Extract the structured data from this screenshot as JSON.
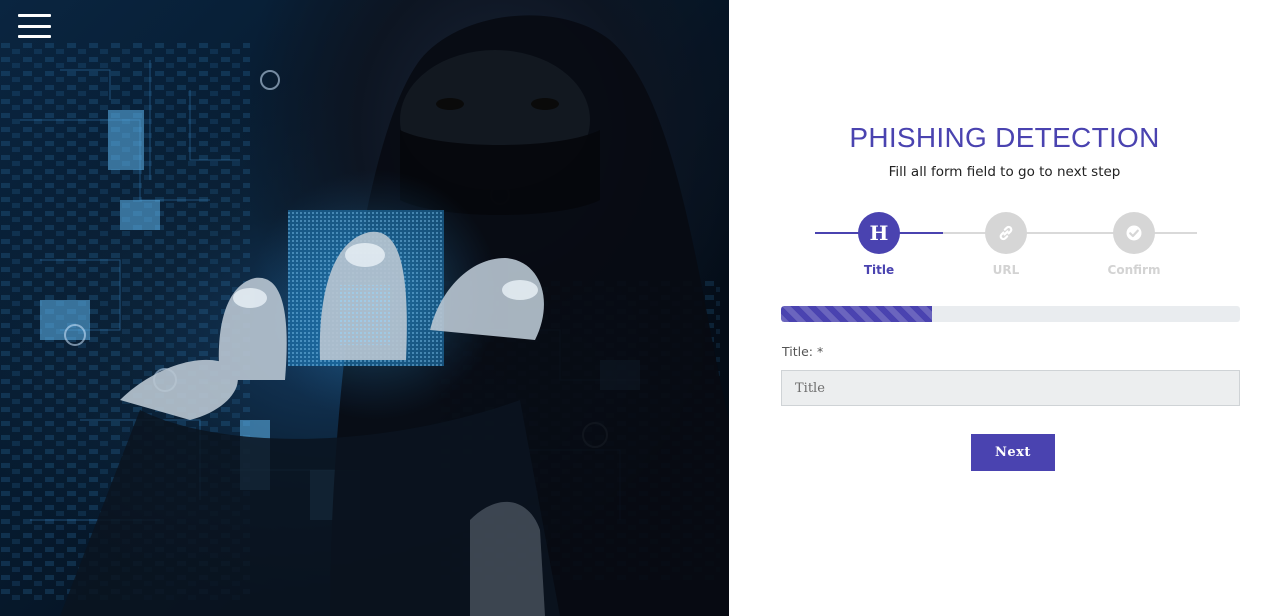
{
  "colors": {
    "accent": "#4a43b0",
    "inactive_step": "#d6d6d6",
    "progress_track": "#e9ecef",
    "input_background": "#eceeef"
  },
  "menu": {
    "icon": "hamburger-menu-icon"
  },
  "hero": {
    "image": "hooded-hacker-with-circuit-board"
  },
  "form": {
    "title": "PHISHING DETECTION",
    "subtitle": "Fill all form field to go to next step",
    "steps": [
      {
        "symbol": "H",
        "label": "Title",
        "icon": "letter-h-icon",
        "state": "active"
      },
      {
        "symbol": "",
        "label": "URL",
        "icon": "link-icon",
        "state": "inactive"
      },
      {
        "symbol": "",
        "label": "Confirm",
        "icon": "check-circle-icon",
        "state": "inactive"
      }
    ],
    "progress": 0.33,
    "field": {
      "label": "Title: *",
      "value": "",
      "placeholder": "Title"
    },
    "next_label": "Next"
  }
}
